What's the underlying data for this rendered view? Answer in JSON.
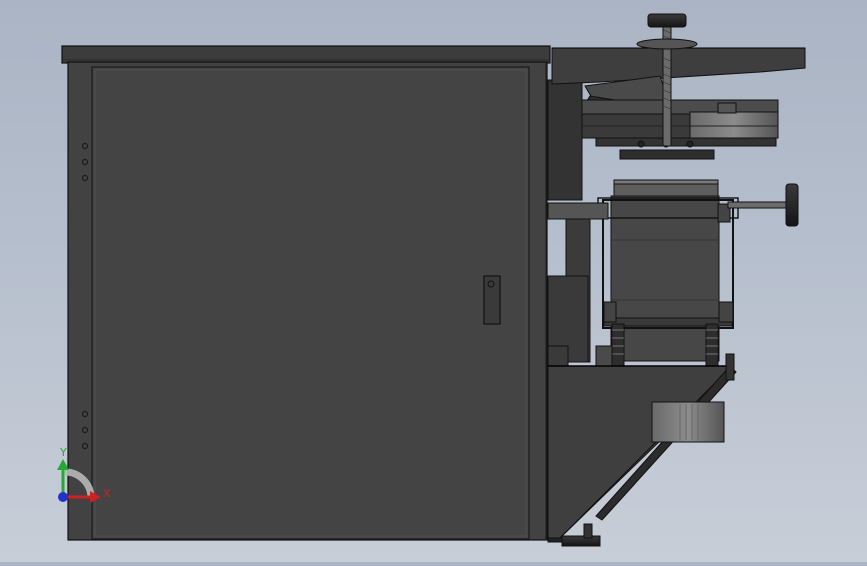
{
  "viewport": {
    "background_top": "#aab4c4",
    "background_bottom": "#c8ced8"
  },
  "model": {
    "body_color": "#404040",
    "edge_color": "#111111",
    "metal_color": "#5a5a5a",
    "highlight_color": "#8a8a8a"
  },
  "triad": {
    "x_label": "X",
    "y_label": "Y",
    "x_color": "#cc2222",
    "y_color": "#22aa33",
    "z_color": "#2233cc"
  }
}
